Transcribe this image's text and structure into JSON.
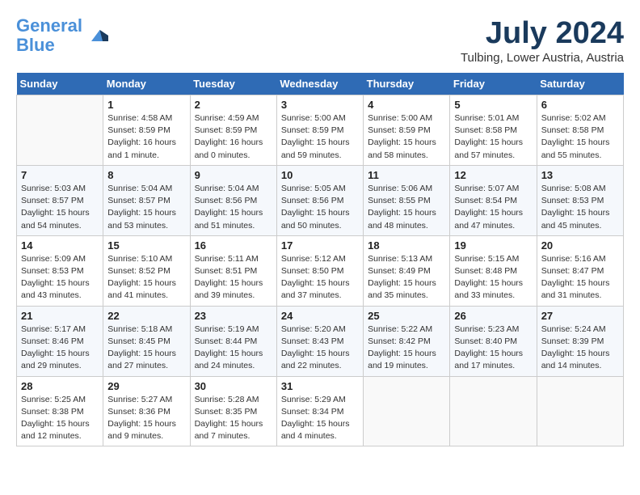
{
  "header": {
    "logo_line1": "General",
    "logo_line2": "Blue",
    "month_title": "July 2024",
    "location": "Tulbing, Lower Austria, Austria"
  },
  "weekdays": [
    "Sunday",
    "Monday",
    "Tuesday",
    "Wednesday",
    "Thursday",
    "Friday",
    "Saturday"
  ],
  "weeks": [
    [
      {
        "day": "",
        "info": ""
      },
      {
        "day": "1",
        "info": "Sunrise: 4:58 AM\nSunset: 8:59 PM\nDaylight: 16 hours\nand 1 minute."
      },
      {
        "day": "2",
        "info": "Sunrise: 4:59 AM\nSunset: 8:59 PM\nDaylight: 16 hours\nand 0 minutes."
      },
      {
        "day": "3",
        "info": "Sunrise: 5:00 AM\nSunset: 8:59 PM\nDaylight: 15 hours\nand 59 minutes."
      },
      {
        "day": "4",
        "info": "Sunrise: 5:00 AM\nSunset: 8:59 PM\nDaylight: 15 hours\nand 58 minutes."
      },
      {
        "day": "5",
        "info": "Sunrise: 5:01 AM\nSunset: 8:58 PM\nDaylight: 15 hours\nand 57 minutes."
      },
      {
        "day": "6",
        "info": "Sunrise: 5:02 AM\nSunset: 8:58 PM\nDaylight: 15 hours\nand 55 minutes."
      }
    ],
    [
      {
        "day": "7",
        "info": "Sunrise: 5:03 AM\nSunset: 8:57 PM\nDaylight: 15 hours\nand 54 minutes."
      },
      {
        "day": "8",
        "info": "Sunrise: 5:04 AM\nSunset: 8:57 PM\nDaylight: 15 hours\nand 53 minutes."
      },
      {
        "day": "9",
        "info": "Sunrise: 5:04 AM\nSunset: 8:56 PM\nDaylight: 15 hours\nand 51 minutes."
      },
      {
        "day": "10",
        "info": "Sunrise: 5:05 AM\nSunset: 8:56 PM\nDaylight: 15 hours\nand 50 minutes."
      },
      {
        "day": "11",
        "info": "Sunrise: 5:06 AM\nSunset: 8:55 PM\nDaylight: 15 hours\nand 48 minutes."
      },
      {
        "day": "12",
        "info": "Sunrise: 5:07 AM\nSunset: 8:54 PM\nDaylight: 15 hours\nand 47 minutes."
      },
      {
        "day": "13",
        "info": "Sunrise: 5:08 AM\nSunset: 8:53 PM\nDaylight: 15 hours\nand 45 minutes."
      }
    ],
    [
      {
        "day": "14",
        "info": "Sunrise: 5:09 AM\nSunset: 8:53 PM\nDaylight: 15 hours\nand 43 minutes."
      },
      {
        "day": "15",
        "info": "Sunrise: 5:10 AM\nSunset: 8:52 PM\nDaylight: 15 hours\nand 41 minutes."
      },
      {
        "day": "16",
        "info": "Sunrise: 5:11 AM\nSunset: 8:51 PM\nDaylight: 15 hours\nand 39 minutes."
      },
      {
        "day": "17",
        "info": "Sunrise: 5:12 AM\nSunset: 8:50 PM\nDaylight: 15 hours\nand 37 minutes."
      },
      {
        "day": "18",
        "info": "Sunrise: 5:13 AM\nSunset: 8:49 PM\nDaylight: 15 hours\nand 35 minutes."
      },
      {
        "day": "19",
        "info": "Sunrise: 5:15 AM\nSunset: 8:48 PM\nDaylight: 15 hours\nand 33 minutes."
      },
      {
        "day": "20",
        "info": "Sunrise: 5:16 AM\nSunset: 8:47 PM\nDaylight: 15 hours\nand 31 minutes."
      }
    ],
    [
      {
        "day": "21",
        "info": "Sunrise: 5:17 AM\nSunset: 8:46 PM\nDaylight: 15 hours\nand 29 minutes."
      },
      {
        "day": "22",
        "info": "Sunrise: 5:18 AM\nSunset: 8:45 PM\nDaylight: 15 hours\nand 27 minutes."
      },
      {
        "day": "23",
        "info": "Sunrise: 5:19 AM\nSunset: 8:44 PM\nDaylight: 15 hours\nand 24 minutes."
      },
      {
        "day": "24",
        "info": "Sunrise: 5:20 AM\nSunset: 8:43 PM\nDaylight: 15 hours\nand 22 minutes."
      },
      {
        "day": "25",
        "info": "Sunrise: 5:22 AM\nSunset: 8:42 PM\nDaylight: 15 hours\nand 19 minutes."
      },
      {
        "day": "26",
        "info": "Sunrise: 5:23 AM\nSunset: 8:40 PM\nDaylight: 15 hours\nand 17 minutes."
      },
      {
        "day": "27",
        "info": "Sunrise: 5:24 AM\nSunset: 8:39 PM\nDaylight: 15 hours\nand 14 minutes."
      }
    ],
    [
      {
        "day": "28",
        "info": "Sunrise: 5:25 AM\nSunset: 8:38 PM\nDaylight: 15 hours\nand 12 minutes."
      },
      {
        "day": "29",
        "info": "Sunrise: 5:27 AM\nSunset: 8:36 PM\nDaylight: 15 hours\nand 9 minutes."
      },
      {
        "day": "30",
        "info": "Sunrise: 5:28 AM\nSunset: 8:35 PM\nDaylight: 15 hours\nand 7 minutes."
      },
      {
        "day": "31",
        "info": "Sunrise: 5:29 AM\nSunset: 8:34 PM\nDaylight: 15 hours\nand 4 minutes."
      },
      {
        "day": "",
        "info": ""
      },
      {
        "day": "",
        "info": ""
      },
      {
        "day": "",
        "info": ""
      }
    ]
  ]
}
